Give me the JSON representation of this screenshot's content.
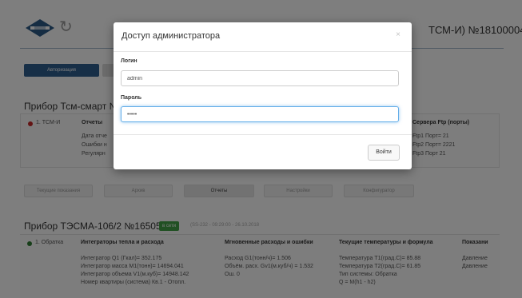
{
  "header": {
    "device_title": "ТСМ-И) №18100004"
  },
  "auth_button": "Авторизация",
  "section1": {
    "title": "Прибор Тсм-смарт №",
    "channel": "1. ТСМ-И",
    "reports_label": "Отчеты",
    "rows": [
      "Дата отче",
      "Ошибки н",
      "Регулярн"
    ],
    "ftp_header": "Сервера Ftp (порты)",
    "ftp_lines": [
      "Ftp1 Порт= 21",
      "Ftp2 Порт= 2221",
      "Ftp3 Порт 21"
    ]
  },
  "tabs": [
    "Текущие показания",
    "Архив",
    "Отчеты",
    "Настройки",
    "Конфигуратор"
  ],
  "section2": {
    "title": "Прибор ТЭСМА-106/2 №165056",
    "badge": "в сети",
    "subtitle": "(SS-232 - 09:29:00 - 26.10.2018",
    "channel": "1. Обратка",
    "col1_header": "Интеграторы тепла и расхода",
    "col1_lines": [
      "Интегратор Q1 (Гкал)= 352.175",
      "Интегратор масса M1(тонн)= 14694.041",
      "Интегратор объема V1(м.куб)= 14948.142",
      "Номер квартиры (система) Кв.1 - Отопл."
    ],
    "col2_header": "Мгновенные расходы и ошибки",
    "col2_lines": [
      "Расход G1(тонн/ч)= 1.506",
      "Объём. расх. Gv1(м.куб/ч) = 1.532",
      "Ош. 0"
    ],
    "col3_header": "Текущие температуры и формула",
    "col3_lines": [
      "Температура T1(град.С)= 85.88",
      "Температура T2(град.С)= 61.85",
      "Тип системы: Обратка",
      "Q = M(h1 - h2)"
    ],
    "col4_header": "Показани",
    "col4_lines": [
      "Давление",
      "Давление"
    ]
  },
  "modal": {
    "title": "Доступ администратора",
    "close": "×",
    "login_label": "Логин",
    "login_value": "admin",
    "password_label": "Пароль",
    "password_value": "•••••",
    "submit": "Войти"
  }
}
